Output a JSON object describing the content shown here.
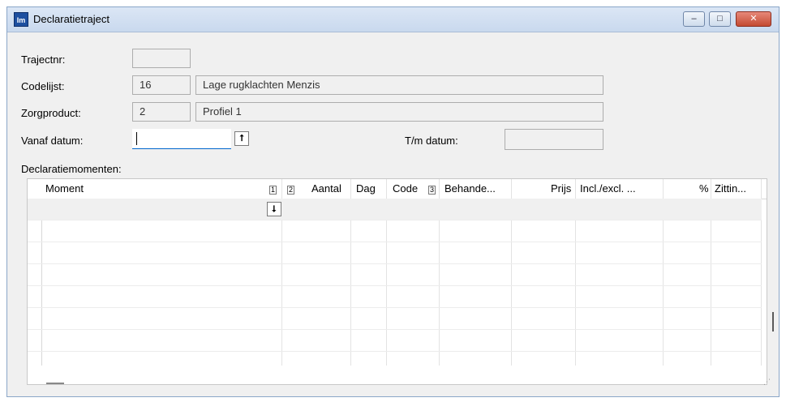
{
  "window": {
    "title": "Declaratietraject",
    "icon_text": "Im",
    "controls": {
      "minimize": "–",
      "maximize": "□",
      "close": "✕"
    }
  },
  "form": {
    "trajectnr_label": "Trajectnr:",
    "trajectnr_value": "",
    "codelijst_label": "Codelijst:",
    "codelijst_code": "16",
    "codelijst_desc": "Lage rugklachten Menzis",
    "zorgproduct_label": "Zorgproduct:",
    "zorgproduct_code": "2",
    "zorgproduct_desc": "Profiel 1",
    "vanaf_label": "Vanaf datum:",
    "vanaf_value": "",
    "tm_label": "T/m datum:",
    "tm_value": ""
  },
  "grid": {
    "section_label": "Declaratiemomenten:",
    "columns": [
      "Moment",
      "Aantal",
      "Dag",
      "Code",
      "Behande...",
      "Prijs",
      "Incl./excl. ...",
      "%",
      "Zittin..."
    ],
    "sort_icons": [
      "1",
      "2",
      "3"
    ]
  }
}
